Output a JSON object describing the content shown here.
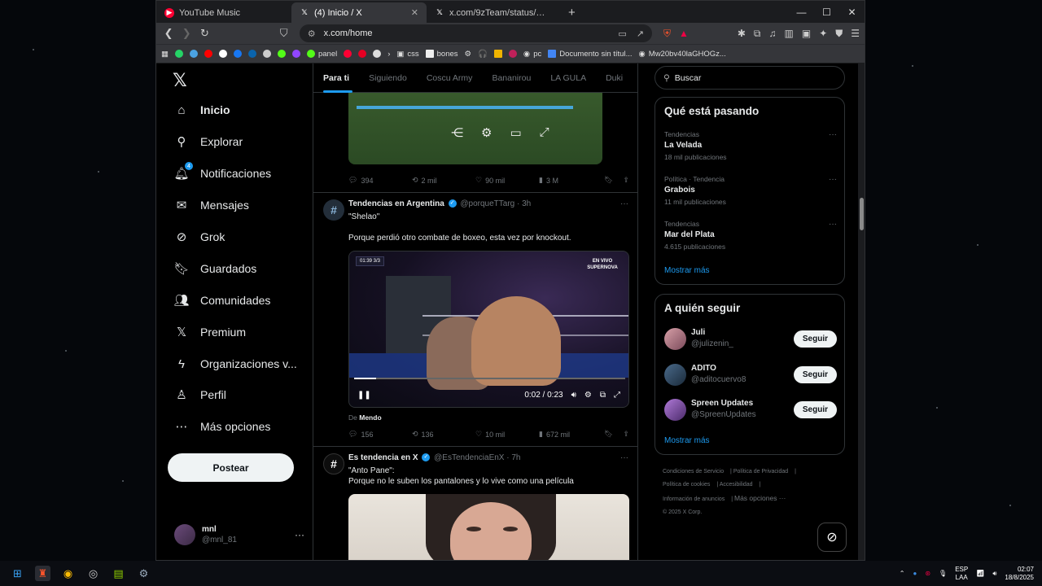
{
  "browser": {
    "tabs": [
      {
        "title": "YouTube Music",
        "icon": "youtube-music-icon",
        "active": false
      },
      {
        "title": "(4) Inicio / X",
        "icon": "x-logo-icon",
        "active": true
      },
      {
        "title": "x.com/9zTeam/status/19571743128...",
        "icon": "x-logo-icon",
        "active": false
      }
    ],
    "url": "x.com/home",
    "new_tab": "+",
    "bookmarks": [
      {
        "label": "",
        "icon": "whatsapp-icon"
      },
      {
        "label": "",
        "icon": "cloud-icon"
      },
      {
        "label": "",
        "icon": "youtube-icon"
      },
      {
        "label": "",
        "icon": "google-icon"
      },
      {
        "label": "",
        "icon": "facebook-icon"
      },
      {
        "label": "",
        "icon": "outlook-icon"
      },
      {
        "label": "",
        "icon": "drive-icon"
      },
      {
        "label": "",
        "icon": "kick-icon"
      },
      {
        "label": "",
        "icon": "twitch-icon"
      },
      {
        "label": "panel",
        "icon": "kick-icon"
      },
      {
        "label": "",
        "icon": "music-icon"
      },
      {
        "label": "",
        "icon": "pinterest-icon"
      },
      {
        "label": "",
        "icon": "github-icon"
      },
      {
        "label": "",
        "icon": "x-icon"
      },
      {
        "label": "css",
        "icon": "css-icon"
      },
      {
        "label": "bones",
        "icon": "page-icon"
      },
      {
        "label": "",
        "icon": "steam-icon"
      },
      {
        "label": "",
        "icon": "headphones-icon"
      },
      {
        "label": "",
        "icon": "bookmark-icon"
      },
      {
        "label": "",
        "icon": "compass-icon"
      },
      {
        "label": "pc",
        "icon": "github-icon"
      },
      {
        "label": "Documento sin títul...",
        "icon": "docs-icon"
      },
      {
        "label": "Mw20bv40laGHOGz...",
        "icon": "github-icon"
      }
    ]
  },
  "nav": {
    "items": [
      {
        "label": "Inicio",
        "icon": "home-icon",
        "active": true
      },
      {
        "label": "Explorar",
        "icon": "search-icon",
        "active": false
      },
      {
        "label": "Notificaciones",
        "icon": "bell-icon",
        "active": false,
        "badge": "4"
      },
      {
        "label": "Mensajes",
        "icon": "mail-icon",
        "active": false
      },
      {
        "label": "Grok",
        "icon": "grok-icon",
        "active": false
      },
      {
        "label": "Guardados",
        "icon": "bookmark-icon",
        "active": false
      },
      {
        "label": "Comunidades",
        "icon": "communities-icon",
        "active": false
      },
      {
        "label": "Premium",
        "icon": "x-logo-icon",
        "active": false
      },
      {
        "label": "Organizaciones v...",
        "icon": "lightning-icon",
        "active": false
      },
      {
        "label": "Perfil",
        "icon": "person-icon",
        "active": false
      },
      {
        "label": "Más opciones",
        "icon": "more-circle-icon",
        "active": false
      }
    ],
    "post_button": "Postear",
    "account": {
      "name": "mnl",
      "handle": "@mnl_81",
      "more": "···"
    }
  },
  "feed": {
    "tabs": [
      "Para ti",
      "Siguiendo",
      "Coscu Army",
      "Bananirou",
      "LA GULA",
      "Duki"
    ],
    "first_post_actions": {
      "replies": "394",
      "reposts": "2 mil",
      "likes": "90 mil",
      "views": "3 M"
    },
    "posts": [
      {
        "author": "Tendencias en Argentina",
        "handle": "@porqueTTarg",
        "time": "3h",
        "text_line1": "\"Shelao\"",
        "text_line2": "Porque perdió otro combate de boxeo, esta vez por knockout.",
        "video": {
          "time": "0:02 / 0:23",
          "overlay_logo": "EN VIVO SUPERNOVA",
          "score": "01:39 3/3",
          "progress": 0.08
        },
        "from_label": "De",
        "from_name": "Mendo",
        "actions": {
          "replies": "156",
          "reposts": "136",
          "likes": "10 mil",
          "views": "672 mil"
        }
      },
      {
        "author": "Es tendencia en X",
        "handle": "@EsTendenciaEnX",
        "time": "7h",
        "text_line1": "\"Anto Pane\":",
        "text_line2": "Porque no le suben los pantalones y lo vive como una película"
      }
    ]
  },
  "sidebar": {
    "search_placeholder": "Buscar",
    "trends_title": "Qué está pasando",
    "trends": [
      {
        "category": "Tendencias",
        "title": "La Velada",
        "count": "18 mil publicaciones"
      },
      {
        "category": "Política · Tendencia",
        "title": "Grabois",
        "count": "11 mil publicaciones"
      },
      {
        "category": "Tendencias",
        "title": "Mar del Plata",
        "count": "4.615 publicaciones"
      }
    ],
    "show_more": "Mostrar más",
    "who_title": "A quién seguir",
    "who": [
      {
        "name": "Juli",
        "handle": "@julizenin_",
        "button": "Seguir"
      },
      {
        "name": "ADITO",
        "handle": "@aditocuervo8",
        "button": "Seguir"
      },
      {
        "name": "Spreen Updates",
        "handle": "@SpreenUpdates",
        "button": "Seguir"
      }
    ],
    "footer": [
      "Condiciones de Servicio",
      "Política de Privacidad",
      "Política de cookies",
      "Accesibilidad",
      "Información de anuncios",
      "Más opciones ···",
      "© 2025 X Corp."
    ]
  },
  "taskbar": {
    "lang_line1": "ESP",
    "lang_line2": "LAA",
    "time": "02:07",
    "date": "18/8/2025"
  },
  "colors": {
    "accent": "#1d9bf0",
    "background": "#000000",
    "brave": "#fb542b"
  }
}
